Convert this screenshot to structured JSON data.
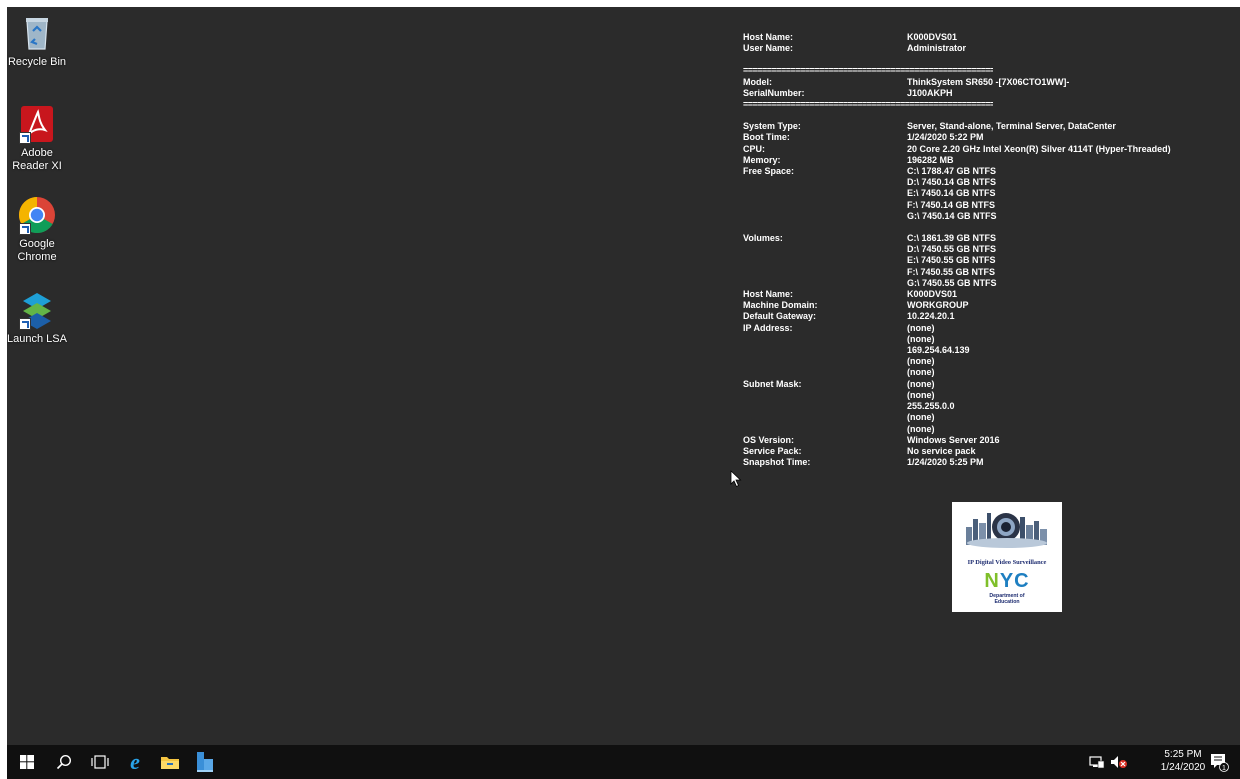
{
  "desktop_icons": [
    {
      "label": "Recycle Bin",
      "icon": "recycle-bin-icon"
    },
    {
      "label": "Adobe Reader XI",
      "icon": "adobe-reader-icon"
    },
    {
      "label": "Google Chrome",
      "icon": "chrome-icon"
    },
    {
      "label": "Launch LSA",
      "icon": "lsa-icon"
    }
  ],
  "sysinfo": {
    "host_name_label": "Host Name:",
    "host_name": "K000DVS01",
    "user_name_label": "User Name:",
    "user_name": "Administrator",
    "separator": "==========================================================",
    "model_label": "Model:",
    "model": "ThinkSystem SR650 -[7X06CTO1WW]-",
    "serial_label": "SerialNumber:",
    "serial": "J100AKPH",
    "system_type_label": "System Type:",
    "system_type": "Server, Stand-alone, Terminal Server, DataCenter",
    "boot_time_label": "Boot Time:",
    "boot_time": "1/24/2020 5:22 PM",
    "cpu_label": "CPU:",
    "cpu": "20 Core 2.20 GHz Intel Xeon(R) Silver 4114T (Hyper-Threaded)",
    "memory_label": "Memory:",
    "memory": "196282 MB",
    "free_space_label": "Free Space:",
    "free_space": [
      "C:\\ 1788.47 GB NTFS",
      "D:\\ 7450.14 GB NTFS",
      "E:\\ 7450.14 GB NTFS",
      "F:\\ 7450.14 GB NTFS",
      "G:\\ 7450.14 GB NTFS"
    ],
    "volumes_label": "Volumes:",
    "volumes": [
      "C:\\ 1861.39 GB NTFS",
      "D:\\ 7450.55 GB NTFS",
      "E:\\ 7450.55 GB NTFS",
      "F:\\ 7450.55 GB NTFS",
      "G:\\ 7450.55 GB NTFS"
    ],
    "host_name2_label": "Host Name:",
    "host_name2": "K000DVS01",
    "machine_domain_label": "Machine Domain:",
    "machine_domain": "WORKGROUP",
    "default_gateway_label": "Default Gateway:",
    "default_gateway": "10.224.20.1",
    "ip_address_label": "IP Address:",
    "ip_addresses": [
      "(none)",
      "(none)",
      "169.254.64.139",
      "(none)",
      "(none)"
    ],
    "subnet_mask_label": "Subnet Mask:",
    "subnet_masks": [
      "(none)",
      "(none)",
      "255.255.0.0",
      "(none)",
      "(none)"
    ],
    "os_version_label": "OS Version:",
    "os_version": "Windows Server 2016",
    "service_pack_label": "Service Pack:",
    "service_pack": "No service pack",
    "snapshot_time_label": "Snapshot Time:",
    "snapshot_time": "1/24/2020 5:25 PM"
  },
  "logo": {
    "line1": "IP Digital Video Surveillance",
    "nyc_n": "N",
    "nyc_y": "Y",
    "nyc_c": "C",
    "line2": "Department of",
    "line3": "Education"
  },
  "taskbar": {
    "items": [
      "start-icon",
      "search-icon",
      "task-view-icon",
      "internet-explorer-icon",
      "file-explorer-icon",
      "server-manager-icon"
    ],
    "clock_time": "5:25 PM",
    "clock_date": "1/24/2020",
    "notification_count": "1"
  },
  "colors": {
    "desktop_bg": "#2b2b2b",
    "taskbar_bg": "#101010",
    "text": "#ffffff"
  }
}
